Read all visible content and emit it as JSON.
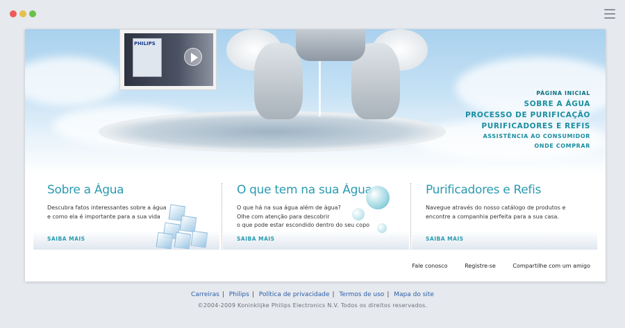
{
  "nav": {
    "items": [
      {
        "label": "PÁGINA INICIAL",
        "size": "sm"
      },
      {
        "label": "SOBRE A ÁGUA",
        "size": "lg"
      },
      {
        "label": "PROCESSO DE PURIFICAÇÃO",
        "size": "lg"
      },
      {
        "label": "PURIFICADORES E REFIS",
        "size": "lg"
      },
      {
        "label": "ASSISTÊNCIA AO CONSUMIDOR",
        "size": "sm"
      },
      {
        "label": "ONDE COMPRAR",
        "size": "sm"
      }
    ]
  },
  "video": {
    "brand": "PHILIPS"
  },
  "panels": [
    {
      "title": "Sobre a Água",
      "lines": [
        "Descubra fatos interessantes sobre a água",
        "e como ela é importante para a sua vida"
      ],
      "more": "SAIBA MAIS"
    },
    {
      "title": "O que tem na sua Água",
      "lines": [
        "O que há na sua água além de água?",
        "Olhe com atenção para descobrir",
        "o que pode estar escondido dentro do seu copo"
      ],
      "more": "SAIBA MAIS"
    },
    {
      "title": "Purificadores e Refis",
      "lines": [
        "Navegue através do nosso catálogo de produtos e",
        "encontre a companhia perfeita para a sua casa."
      ],
      "more": "SAIBA MAIS"
    }
  ],
  "footer_links": [
    "Fale conosco",
    "Registre-se",
    "Compartilhe com um amigo"
  ],
  "legal_links": [
    "Carreiras",
    "Philips",
    "Política de privacidade",
    "Termos de uso",
    "Mapa do site"
  ],
  "copyright": "©2004-2009 Koninklijke Philips Electronics N.V. Todos os direitos reservados."
}
